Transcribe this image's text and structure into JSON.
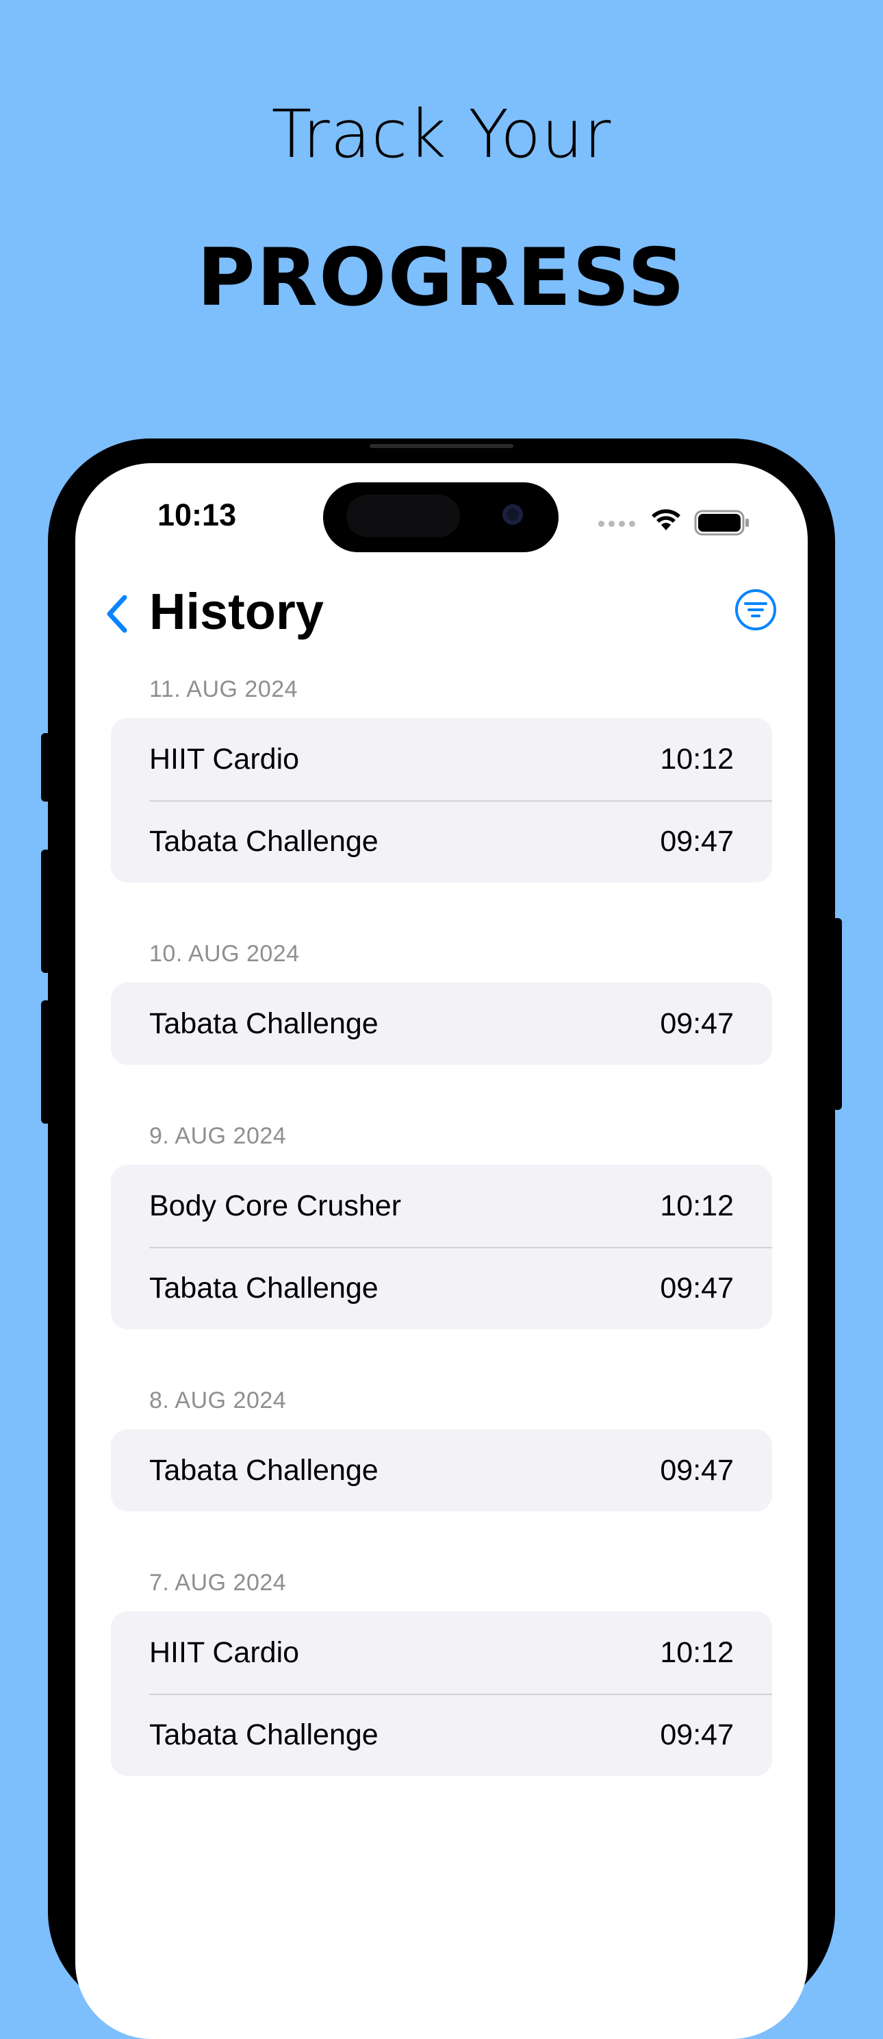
{
  "promo": {
    "line1": "Track Your",
    "line2": "PROGRESS",
    "background_color": "#7dbefd"
  },
  "status_bar": {
    "time": "10:13"
  },
  "nav": {
    "title": "History",
    "accent_color": "#0a84ff",
    "back_icon": "chevron-left-icon",
    "filter_icon": "filter-circle-icon"
  },
  "history": [
    {
      "date": "11. AUG 2024",
      "workouts": [
        {
          "name": "HIIT Cardio",
          "time": "10:12"
        },
        {
          "name": "Tabata Challenge",
          "time": "09:47"
        }
      ]
    },
    {
      "date": "10. AUG 2024",
      "workouts": [
        {
          "name": "Tabata Challenge",
          "time": "09:47"
        }
      ]
    },
    {
      "date": "9. AUG 2024",
      "workouts": [
        {
          "name": "Body Core Crusher",
          "time": "10:12"
        },
        {
          "name": "Tabata Challenge",
          "time": "09:47"
        }
      ]
    },
    {
      "date": "8. AUG 2024",
      "workouts": [
        {
          "name": "Tabata Challenge",
          "time": "09:47"
        }
      ]
    },
    {
      "date": "7. AUG 2024",
      "workouts": [
        {
          "name": "HIIT Cardio",
          "time": "10:12"
        },
        {
          "name": "Tabata Challenge",
          "time": "09:47"
        }
      ]
    }
  ]
}
